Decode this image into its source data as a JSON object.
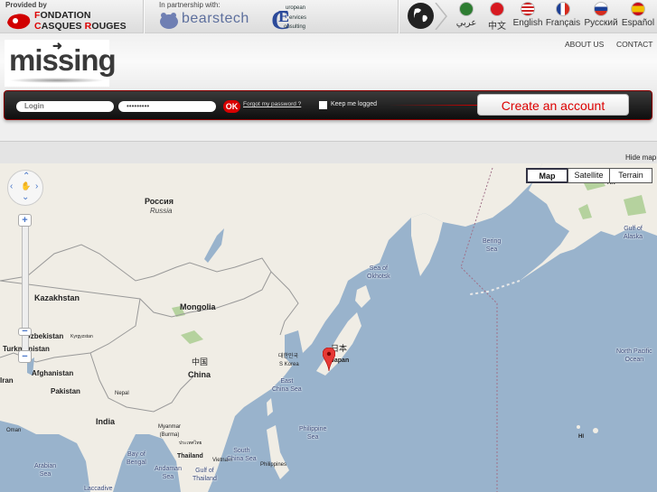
{
  "topbar": {
    "provided_by": "Provided by",
    "foundation_line1": "FONDATION",
    "foundation_line2": "CASQUES ROUGES",
    "partnership": "In partnership with:",
    "partner1": "bearstech",
    "partner2_lines": [
      "uropean",
      "ervices",
      "onsulting"
    ],
    "languages": [
      {
        "label": "عربي",
        "flag_color": "#2e7d32"
      },
      {
        "label": "中文",
        "flag_color": "#d71920"
      },
      {
        "label": "English",
        "flag_color": "#3b5ba5"
      },
      {
        "label": "Français",
        "flag_color": "#1c3f95"
      },
      {
        "label": "Русский",
        "flag_color": "#d52b1e"
      },
      {
        "label": "Español",
        "flag_color": "#f1bf00"
      }
    ]
  },
  "header": {
    "logo": "missing",
    "nav": [
      "ABOUT US",
      "CONTACT"
    ]
  },
  "login": {
    "login_placeholder": "Login",
    "password_value": "•••••••••",
    "ok_label": "OK",
    "forgot_label": "Forgot my password ?",
    "keep_label": "Keep me logged",
    "create_label": "Create an account"
  },
  "map": {
    "hide_label": "Hide map",
    "types": [
      "Map",
      "Satellite",
      "Terrain"
    ],
    "selected_type": "Map",
    "labels": {
      "russia_native": "Россия",
      "russia": "Russia",
      "kazakhstan": "Kazakhstan",
      "mongolia": "Mongolia",
      "uzbekistan": "Uzbekistan",
      "kyrgyzstan": "Kyrgyzstan",
      "turkmenistan": "Turkmenistan",
      "afghanistan": "Afghanistan",
      "iran": "Iran",
      "pakistan": "Pakistan",
      "nepal": "Nepal",
      "india": "India",
      "oman": "Oman",
      "china_native": "中国",
      "china": "China",
      "skorea_native": "대한민국",
      "skorea": "S Korea",
      "japan_native": "日本",
      "japan": "Japan",
      "east_china_sea": "East\nChina Sea",
      "sea_okhotsk": "Sea of\nOkhotsk",
      "bering_sea": "Bering\nSea",
      "gulf_alaska": "Gulf of\nAlaska",
      "north_pacific": "North Pacific\nOcean",
      "hi": "HI",
      "ak": "AK",
      "myanmar": "Myanmar\n(Burma)",
      "thailand_native": "ประเทศไทย",
      "thailand": "Thailand",
      "bay_bengal": "Bay of\nBengal",
      "arabian_sea": "Arabian\nSea",
      "andaman_sea": "Andaman\nSea",
      "gulf_thailand": "Gulf of\nThailand",
      "vietnam": "Vietnam",
      "south_china_sea": "South\nChina Sea",
      "philippines": "Philippines",
      "philippine_sea": "Philippine\nSea",
      "laccadive": "Laccadive"
    }
  }
}
